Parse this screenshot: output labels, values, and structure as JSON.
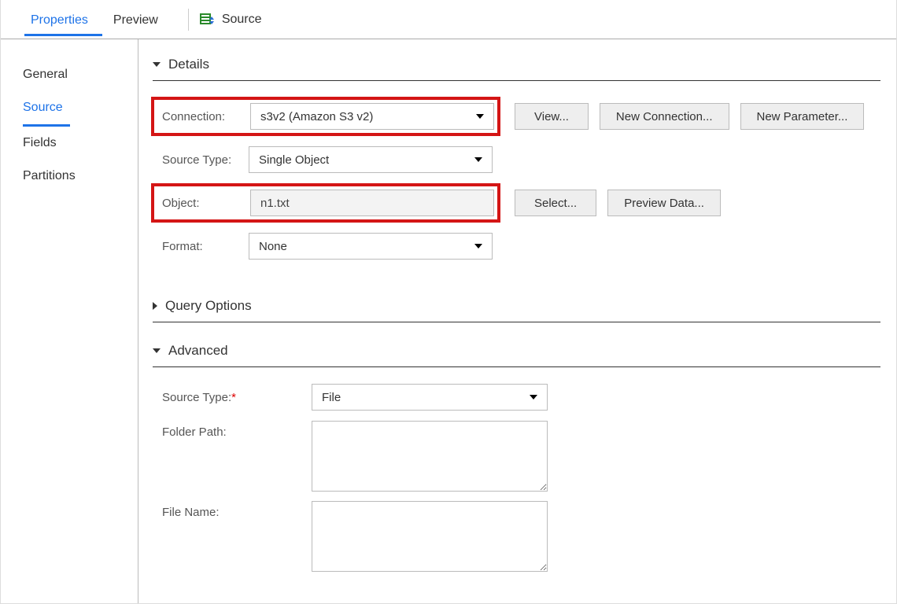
{
  "topTabs": {
    "properties": "Properties",
    "preview": "Preview",
    "sourceLabel": "Source"
  },
  "sidebar": {
    "general": "General",
    "source": "Source",
    "fields": "Fields",
    "partitions": "Partitions"
  },
  "sections": {
    "details": {
      "title": "Details",
      "connectionLabel": "Connection:",
      "connectionValue": "s3v2 (Amazon S3 v2)",
      "viewBtn": "View...",
      "newConnBtn": "New Connection...",
      "newParamBtn": "New Parameter...",
      "sourceTypeLabel": "Source Type:",
      "sourceTypeValue": "Single Object",
      "objectLabel": "Object:",
      "objectValue": "n1.txt",
      "selectBtn": "Select...",
      "previewBtn": "Preview Data...",
      "formatLabel": "Format:",
      "formatValue": "None"
    },
    "queryOptions": {
      "title": "Query Options"
    },
    "advanced": {
      "title": "Advanced",
      "sourceTypeLabel": "Source Type:",
      "sourceTypeValue": "File",
      "folderPathLabel": "Folder Path:",
      "folderPathValue": "",
      "fileNameLabel": "File Name:",
      "fileNameValue": ""
    }
  }
}
